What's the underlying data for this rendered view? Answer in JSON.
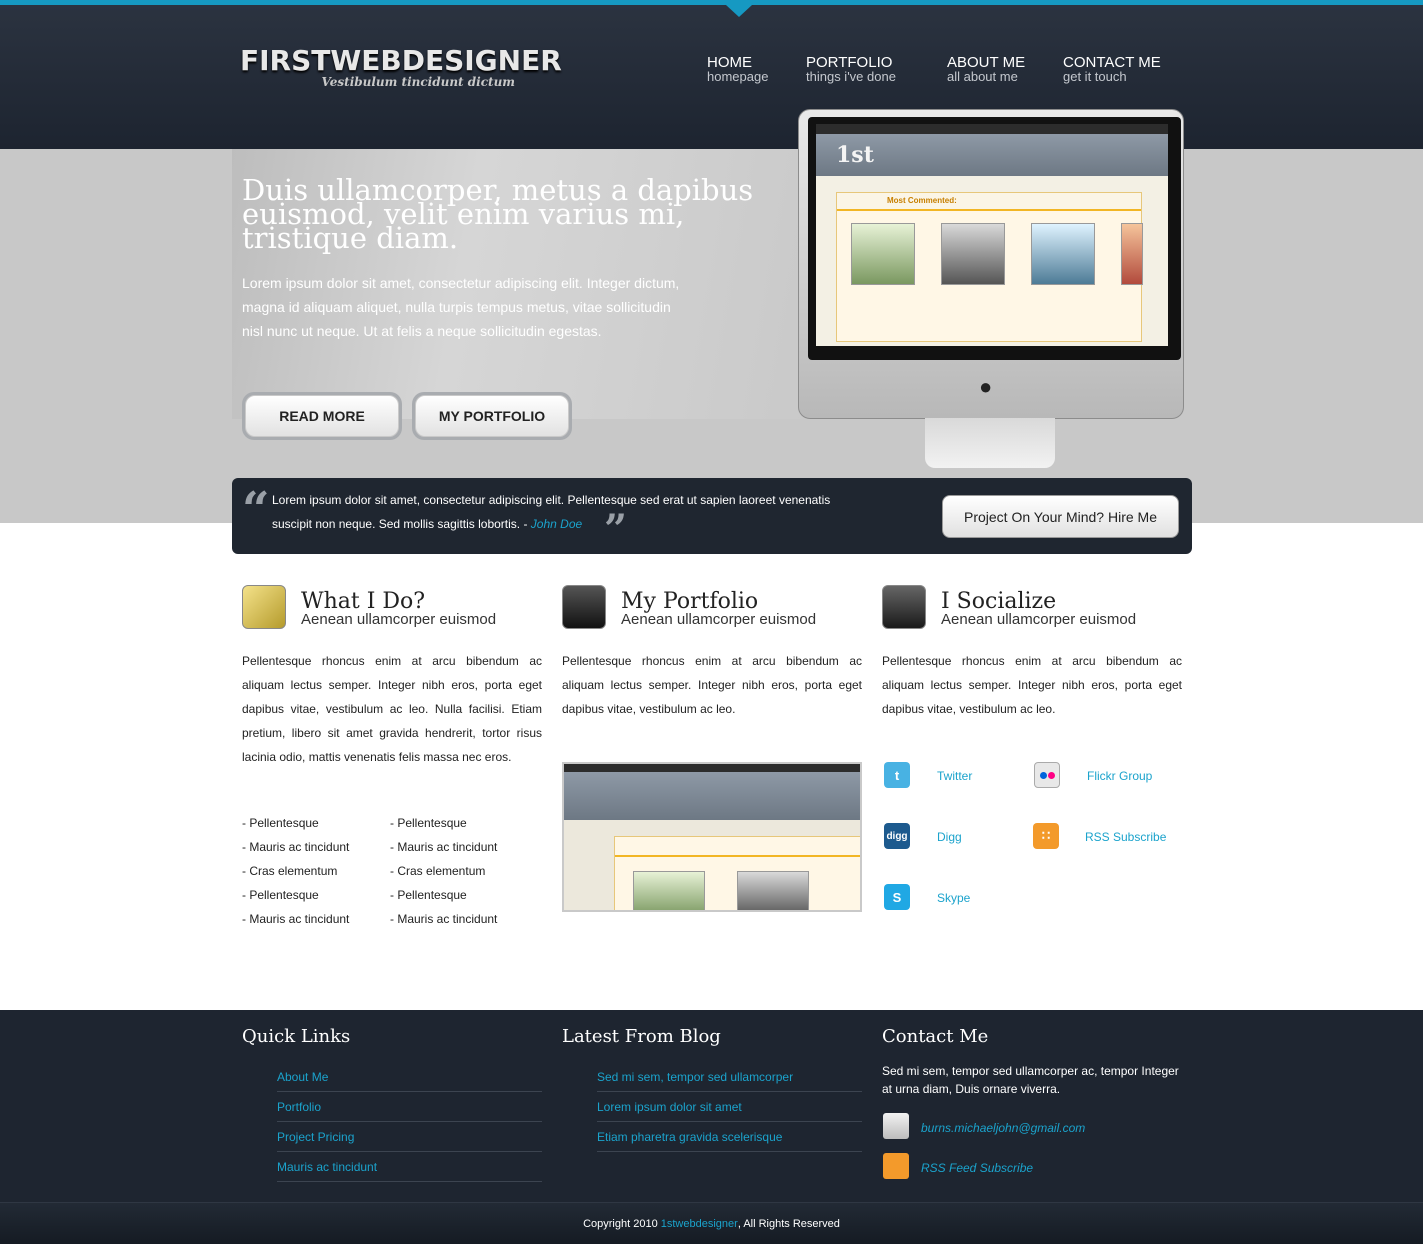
{
  "site": {
    "logo": "FIRSTWEBDESIGNER",
    "tagline": "Vestibulum tincidunt dictum"
  },
  "nav": [
    {
      "main": "HOME",
      "sub": "homepage"
    },
    {
      "main": "PORTFOLIO",
      "sub": "things i've done"
    },
    {
      "main": "ABOUT ME",
      "sub": "all about me"
    },
    {
      "main": "CONTACT ME",
      "sub": "get it touch"
    }
  ],
  "hero": {
    "title": "Duis ullamcorper, metus a dapibus euismod, velit enim varius mi, tristique diam.",
    "text": "Lorem ipsum dolor sit amet, consectetur adipiscing elit. Integer dictum, magna id aliquam aliquet, nulla turpis tempus metus, vitae sollicitudin nisl nunc ut neque. Ut at felis a neque sollicitudin egestas.",
    "btn_read_more": "READ MORE",
    "btn_portfolio": "MY PORTFOLIO",
    "screen_logo": "1st",
    "screen_box_title": "Most Commented:"
  },
  "quote": {
    "text": "Lorem ipsum dolor sit amet, consectetur adipiscing elit. Pellentesque sed erat ut sapien laoreet venenatis suscipit non neque. Sed mollis sagittis lobortis. - ",
    "author": "John Doe",
    "hire_button": "Project On Your Mind? Hire Me"
  },
  "columns": [
    {
      "title": "What I Do?",
      "subtitle": "Aenean ullamcorper euismod",
      "text": "Pellentesque rhoncus enim at arcu bibendum ac aliquam lectus semper. Integer nibh eros, porta eget dapibus vitae, vestibulum ac leo. Nulla facilisi. Etiam pretium, libero sit amet gravida hendrerit, tortor risus lacinia odio, mattis venenatis felis massa nec eros."
    },
    {
      "title": "My Portfolio",
      "subtitle": "Aenean ullamcorper euismod",
      "text": "Pellentesque rhoncus enim at arcu bibendum ac aliquam lectus semper. Integer nibh eros, porta eget dapibus vitae, vestibulum ac leo."
    },
    {
      "title": "I Socialize",
      "subtitle": "Aenean ullamcorper euismod",
      "text": "Pellentesque rhoncus enim at arcu bibendum ac aliquam lectus semper. Integer nibh eros, porta eget dapibus vitae, vestibulum ac leo."
    }
  ],
  "bullets_left": [
    "- Pellentesque",
    "- Mauris ac tincidunt",
    "- Cras elementum",
    "- Pellentesque",
    "- Mauris ac tincidunt"
  ],
  "bullets_right": [
    "- Pellentesque",
    "- Mauris ac tincidunt",
    "- Cras elementum",
    "- Pellentesque",
    "- Mauris ac tincidunt"
  ],
  "social": [
    {
      "label": "Twitter",
      "icon": "twitter-icon"
    },
    {
      "label": "Flickr Group",
      "icon": "flickr-icon"
    },
    {
      "label": "Digg",
      "icon": "digg-icon"
    },
    {
      "label": "RSS Subscribe",
      "icon": "rss-icon"
    },
    {
      "label": "Skype",
      "icon": "skype-icon"
    }
  ],
  "footer": {
    "quick_links_title": "Quick Links",
    "quick_links": [
      "About Me",
      "Portfolio",
      "Project Pricing",
      "Mauris ac tincidunt"
    ],
    "blog_title": "Latest From Blog",
    "blog_links": [
      "Sed mi sem, tempor sed ullamcorper",
      "Lorem ipsum dolor sit amet",
      "Etiam pharetra gravida scelerisque"
    ],
    "contact_title": "Contact Me",
    "contact_text": "Sed mi sem, tempor sed ullamcorper ac, tempor Integer at urna diam, Duis ornare viverra.",
    "email": "burns.michaeljohn@gmail.com",
    "rss": "RSS Feed Subscribe",
    "copyright_prefix": "Copyright 2010 ",
    "copyright_brand": "1stwebdesigner",
    "copyright_suffix": ", All Rights Reserved"
  },
  "colors": {
    "accent": "#1699c2",
    "header_bg": "#1d2430",
    "link": "#1ba3cc"
  }
}
